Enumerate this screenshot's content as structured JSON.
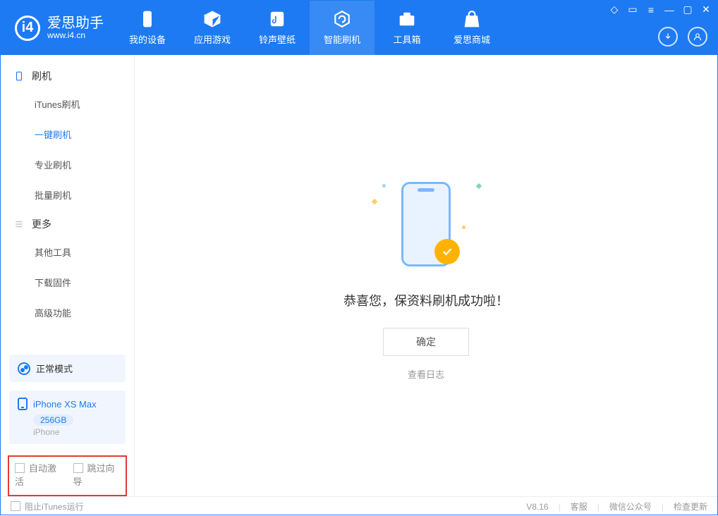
{
  "app": {
    "name_cn": "爱思助手",
    "name_en": "www.i4.cn"
  },
  "nav": {
    "items": [
      {
        "label": "我的设备"
      },
      {
        "label": "应用游戏"
      },
      {
        "label": "铃声壁纸"
      },
      {
        "label": "智能刷机"
      },
      {
        "label": "工具箱"
      },
      {
        "label": "爱思商城"
      }
    ]
  },
  "sidebar": {
    "group1_title": "刷机",
    "group1_items": [
      {
        "label": "iTunes刷机"
      },
      {
        "label": "一键刷机"
      },
      {
        "label": "专业刷机"
      },
      {
        "label": "批量刷机"
      }
    ],
    "group2_title": "更多",
    "group2_items": [
      {
        "label": "其他工具"
      },
      {
        "label": "下载固件"
      },
      {
        "label": "高级功能"
      }
    ],
    "mode_label": "正常模式",
    "device_name": "iPhone XS Max",
    "device_storage": "256GB",
    "device_type": "iPhone",
    "auto_activate_label": "自动激活",
    "skip_wizard_label": "跳过向导"
  },
  "main": {
    "success_msg": "恭喜您，保资料刷机成功啦！",
    "ok_button": "确定",
    "view_log": "查看日志"
  },
  "footer": {
    "block_itunes": "阻止iTunes运行",
    "version": "V8.16",
    "support": "客服",
    "wechat": "微信公众号",
    "check_update": "检查更新"
  }
}
